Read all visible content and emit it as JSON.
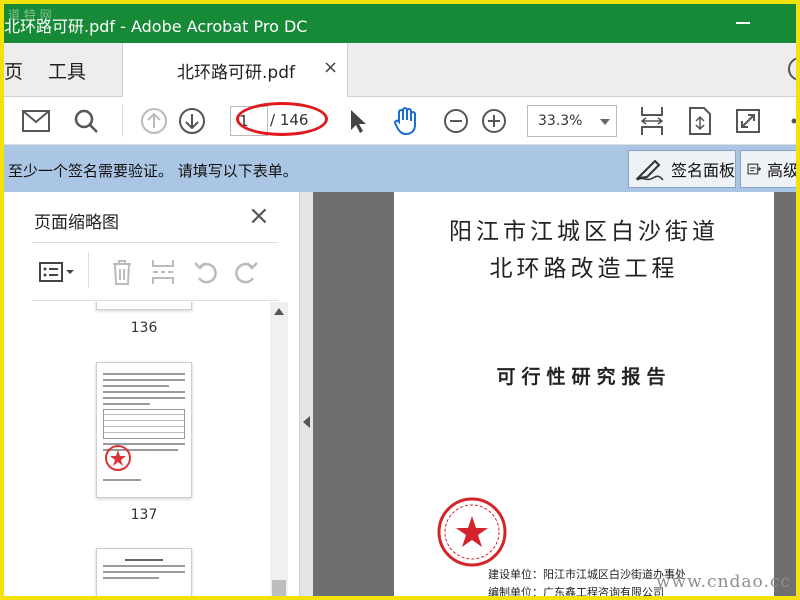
{
  "window": {
    "title": "北环路可研.pdf - Adobe Acrobat Pro DC",
    "watermark_top": "道 特 网"
  },
  "tabs": {
    "home": "页",
    "tools": "工具",
    "document": "北环路可研.pdf",
    "close_glyph": "×"
  },
  "toolbar": {
    "current_page": "1",
    "total_pages": "/ 146",
    "zoom": "33.3%"
  },
  "notice": {
    "message": "至少一个签名需要验证。 请填写以下表单。",
    "sign_panel_button": "签名面板",
    "advanced_button": "高级"
  },
  "thumbnails": {
    "title": "页面缩略图",
    "pages": [
      {
        "label": "136"
      },
      {
        "label": "137"
      }
    ]
  },
  "document": {
    "title_line1": "阳江市江城区白沙街道",
    "title_line2": "北环路改造工程",
    "subtitle": "可行性研究报告",
    "builder_line": "建设单位：阳江市江城区白沙街道办事处",
    "compiler_line": "编制单位：广东鑫工程咨询有限公司"
  },
  "overlay": {
    "site_watermark": "www.cndao.cc"
  },
  "colors": {
    "titlebar": "#178a37",
    "notice_bar": "#aac6e4",
    "annotation_oval": "#e0191f",
    "frame_border": "#f3e10a"
  }
}
